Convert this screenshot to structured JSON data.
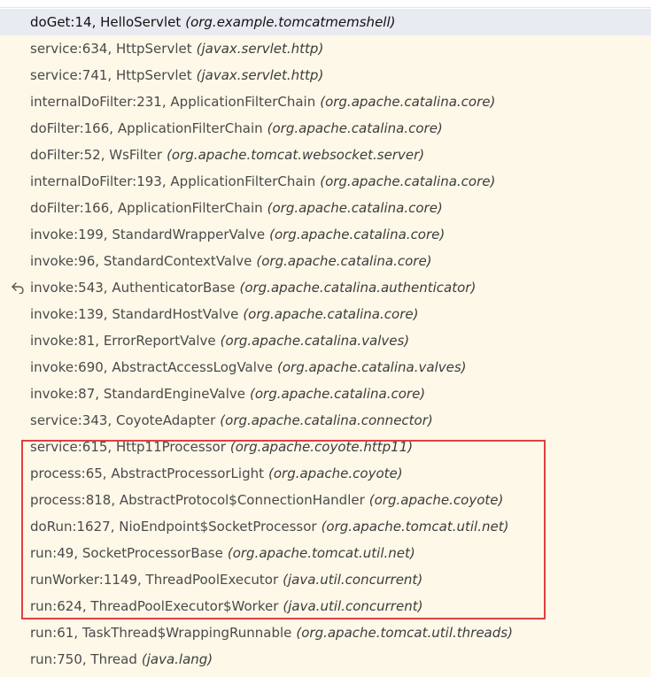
{
  "frames": [
    {
      "method": "doGet:14,",
      "cls": "HelloServlet",
      "pkg": "(org.example.tomcatmemshell)",
      "selected": true
    },
    {
      "method": "service:634,",
      "cls": "HttpServlet",
      "pkg": "(javax.servlet.http)"
    },
    {
      "method": "service:741,",
      "cls": "HttpServlet",
      "pkg": "(javax.servlet.http)"
    },
    {
      "method": "internalDoFilter:231,",
      "cls": "ApplicationFilterChain",
      "pkg": "(org.apache.catalina.core)"
    },
    {
      "method": "doFilter:166,",
      "cls": "ApplicationFilterChain",
      "pkg": "(org.apache.catalina.core)"
    },
    {
      "method": "doFilter:52,",
      "cls": "WsFilter",
      "pkg": "(org.apache.tomcat.websocket.server)"
    },
    {
      "method": "internalDoFilter:193,",
      "cls": "ApplicationFilterChain",
      "pkg": "(org.apache.catalina.core)"
    },
    {
      "method": "doFilter:166,",
      "cls": "ApplicationFilterChain",
      "pkg": "(org.apache.catalina.core)"
    },
    {
      "method": "invoke:199,",
      "cls": "StandardWrapperValve",
      "pkg": "(org.apache.catalina.core)"
    },
    {
      "method": "invoke:96,",
      "cls": "StandardContextValve",
      "pkg": "(org.apache.catalina.core)"
    },
    {
      "method": "invoke:543,",
      "cls": "AuthenticatorBase",
      "pkg": "(org.apache.catalina.authenticator)",
      "icon": "return-arrow-icon"
    },
    {
      "method": "invoke:139,",
      "cls": "StandardHostValve",
      "pkg": "(org.apache.catalina.core)"
    },
    {
      "method": "invoke:81,",
      "cls": "ErrorReportValve",
      "pkg": "(org.apache.catalina.valves)"
    },
    {
      "method": "invoke:690,",
      "cls": "AbstractAccessLogValve",
      "pkg": "(org.apache.catalina.valves)"
    },
    {
      "method": "invoke:87,",
      "cls": "StandardEngineValve",
      "pkg": "(org.apache.catalina.core)"
    },
    {
      "method": "service:343,",
      "cls": "CoyoteAdapter",
      "pkg": "(org.apache.catalina.connector)"
    },
    {
      "method": "service:615,",
      "cls": "Http11Processor",
      "pkg": "(org.apache.coyote.http11)"
    },
    {
      "method": "process:65,",
      "cls": "AbstractProcessorLight",
      "pkg": "(org.apache.coyote)"
    },
    {
      "method": "process:818,",
      "cls": "AbstractProtocol$ConnectionHandler",
      "pkg": "(org.apache.coyote)"
    },
    {
      "method": "doRun:1627,",
      "cls": "NioEndpoint$SocketProcessor",
      "pkg": "(org.apache.tomcat.util.net)"
    },
    {
      "method": "run:49,",
      "cls": "SocketProcessorBase",
      "pkg": "(org.apache.tomcat.util.net)"
    },
    {
      "method": "runWorker:1149,",
      "cls": "ThreadPoolExecutor",
      "pkg": "(java.util.concurrent)"
    },
    {
      "method": "run:624,",
      "cls": "ThreadPoolExecutor$Worker",
      "pkg": "(java.util.concurrent)"
    },
    {
      "method": "run:61,",
      "cls": "TaskThread$WrappingRunnable",
      "pkg": "(org.apache.tomcat.util.threads)"
    },
    {
      "method": "run:750,",
      "cls": "Thread",
      "pkg": "(java.lang)"
    }
  ],
  "colors": {
    "panel_bg": "#fdf8e8",
    "selected_bg": "#e9ebf2",
    "highlight_border": "#e0403f"
  }
}
